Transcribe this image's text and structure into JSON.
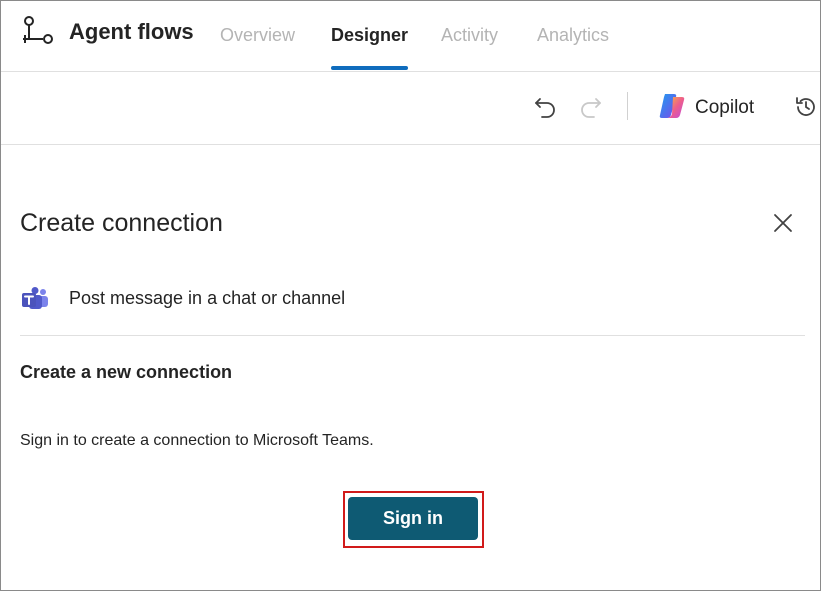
{
  "header": {
    "app_title": "Agent flows",
    "tabs": [
      {
        "label": "Overview",
        "active": false
      },
      {
        "label": "Designer",
        "active": true
      },
      {
        "label": "Activity",
        "active": false
      },
      {
        "label": "Analytics",
        "active": false
      }
    ]
  },
  "toolbar": {
    "undo_icon": "undo-icon",
    "redo_icon": "redo-icon",
    "copilot_label": "Copilot",
    "history_icon": "history-icon"
  },
  "panel": {
    "title": "Create connection",
    "action_icon": "microsoft-teams-icon",
    "action_name": "Post message in a chat or channel",
    "section_title": "Create a new connection",
    "instruction": "Sign in to create a connection to Microsoft Teams.",
    "signin_label": "Sign in"
  },
  "colors": {
    "accent": "#0f6cbd",
    "signin_button": "#0e5a73",
    "highlight_border": "#d11a1a",
    "teams_purple": "#5059c9"
  }
}
